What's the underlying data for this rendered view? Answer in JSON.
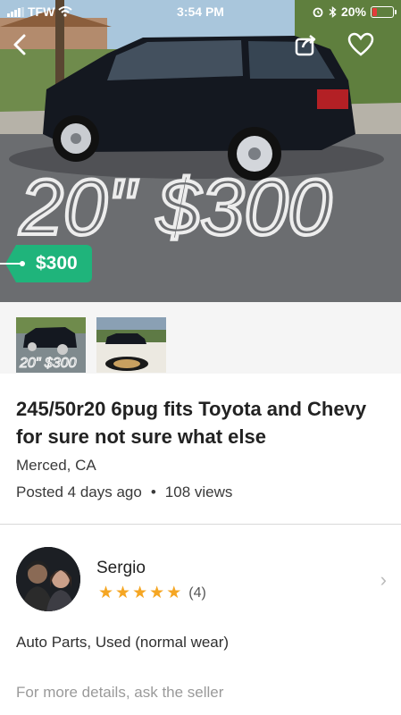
{
  "status_bar": {
    "carrier": "TFW",
    "time": "3:54 PM",
    "battery": "20%",
    "battery_level": 0.2
  },
  "nav": {
    "back_icon": "chevron-left-icon",
    "share_icon": "share-icon",
    "favorite_icon": "heart-icon"
  },
  "listing": {
    "price": "$300",
    "photo_overlay_text": "20\" $300",
    "title": "245/50r20 6pug fits Toyota and Chevy for sure not sure what else",
    "location": "Merced, CA",
    "posted": "Posted 4 days ago",
    "separator": "•",
    "views": "108 views",
    "condition": "Auto Parts, Used (normal wear)",
    "more_details": "For more details, ask the seller",
    "thumbnails": [
      {
        "overlay": "20\" $300"
      },
      {
        "overlay": ""
      }
    ]
  },
  "seller": {
    "name": "Sergio",
    "stars": 5,
    "rating_count": "(4)"
  },
  "colors": {
    "price_tag": "#1fb47b",
    "star": "#f5a623",
    "battery_low": "#e43b3b"
  }
}
